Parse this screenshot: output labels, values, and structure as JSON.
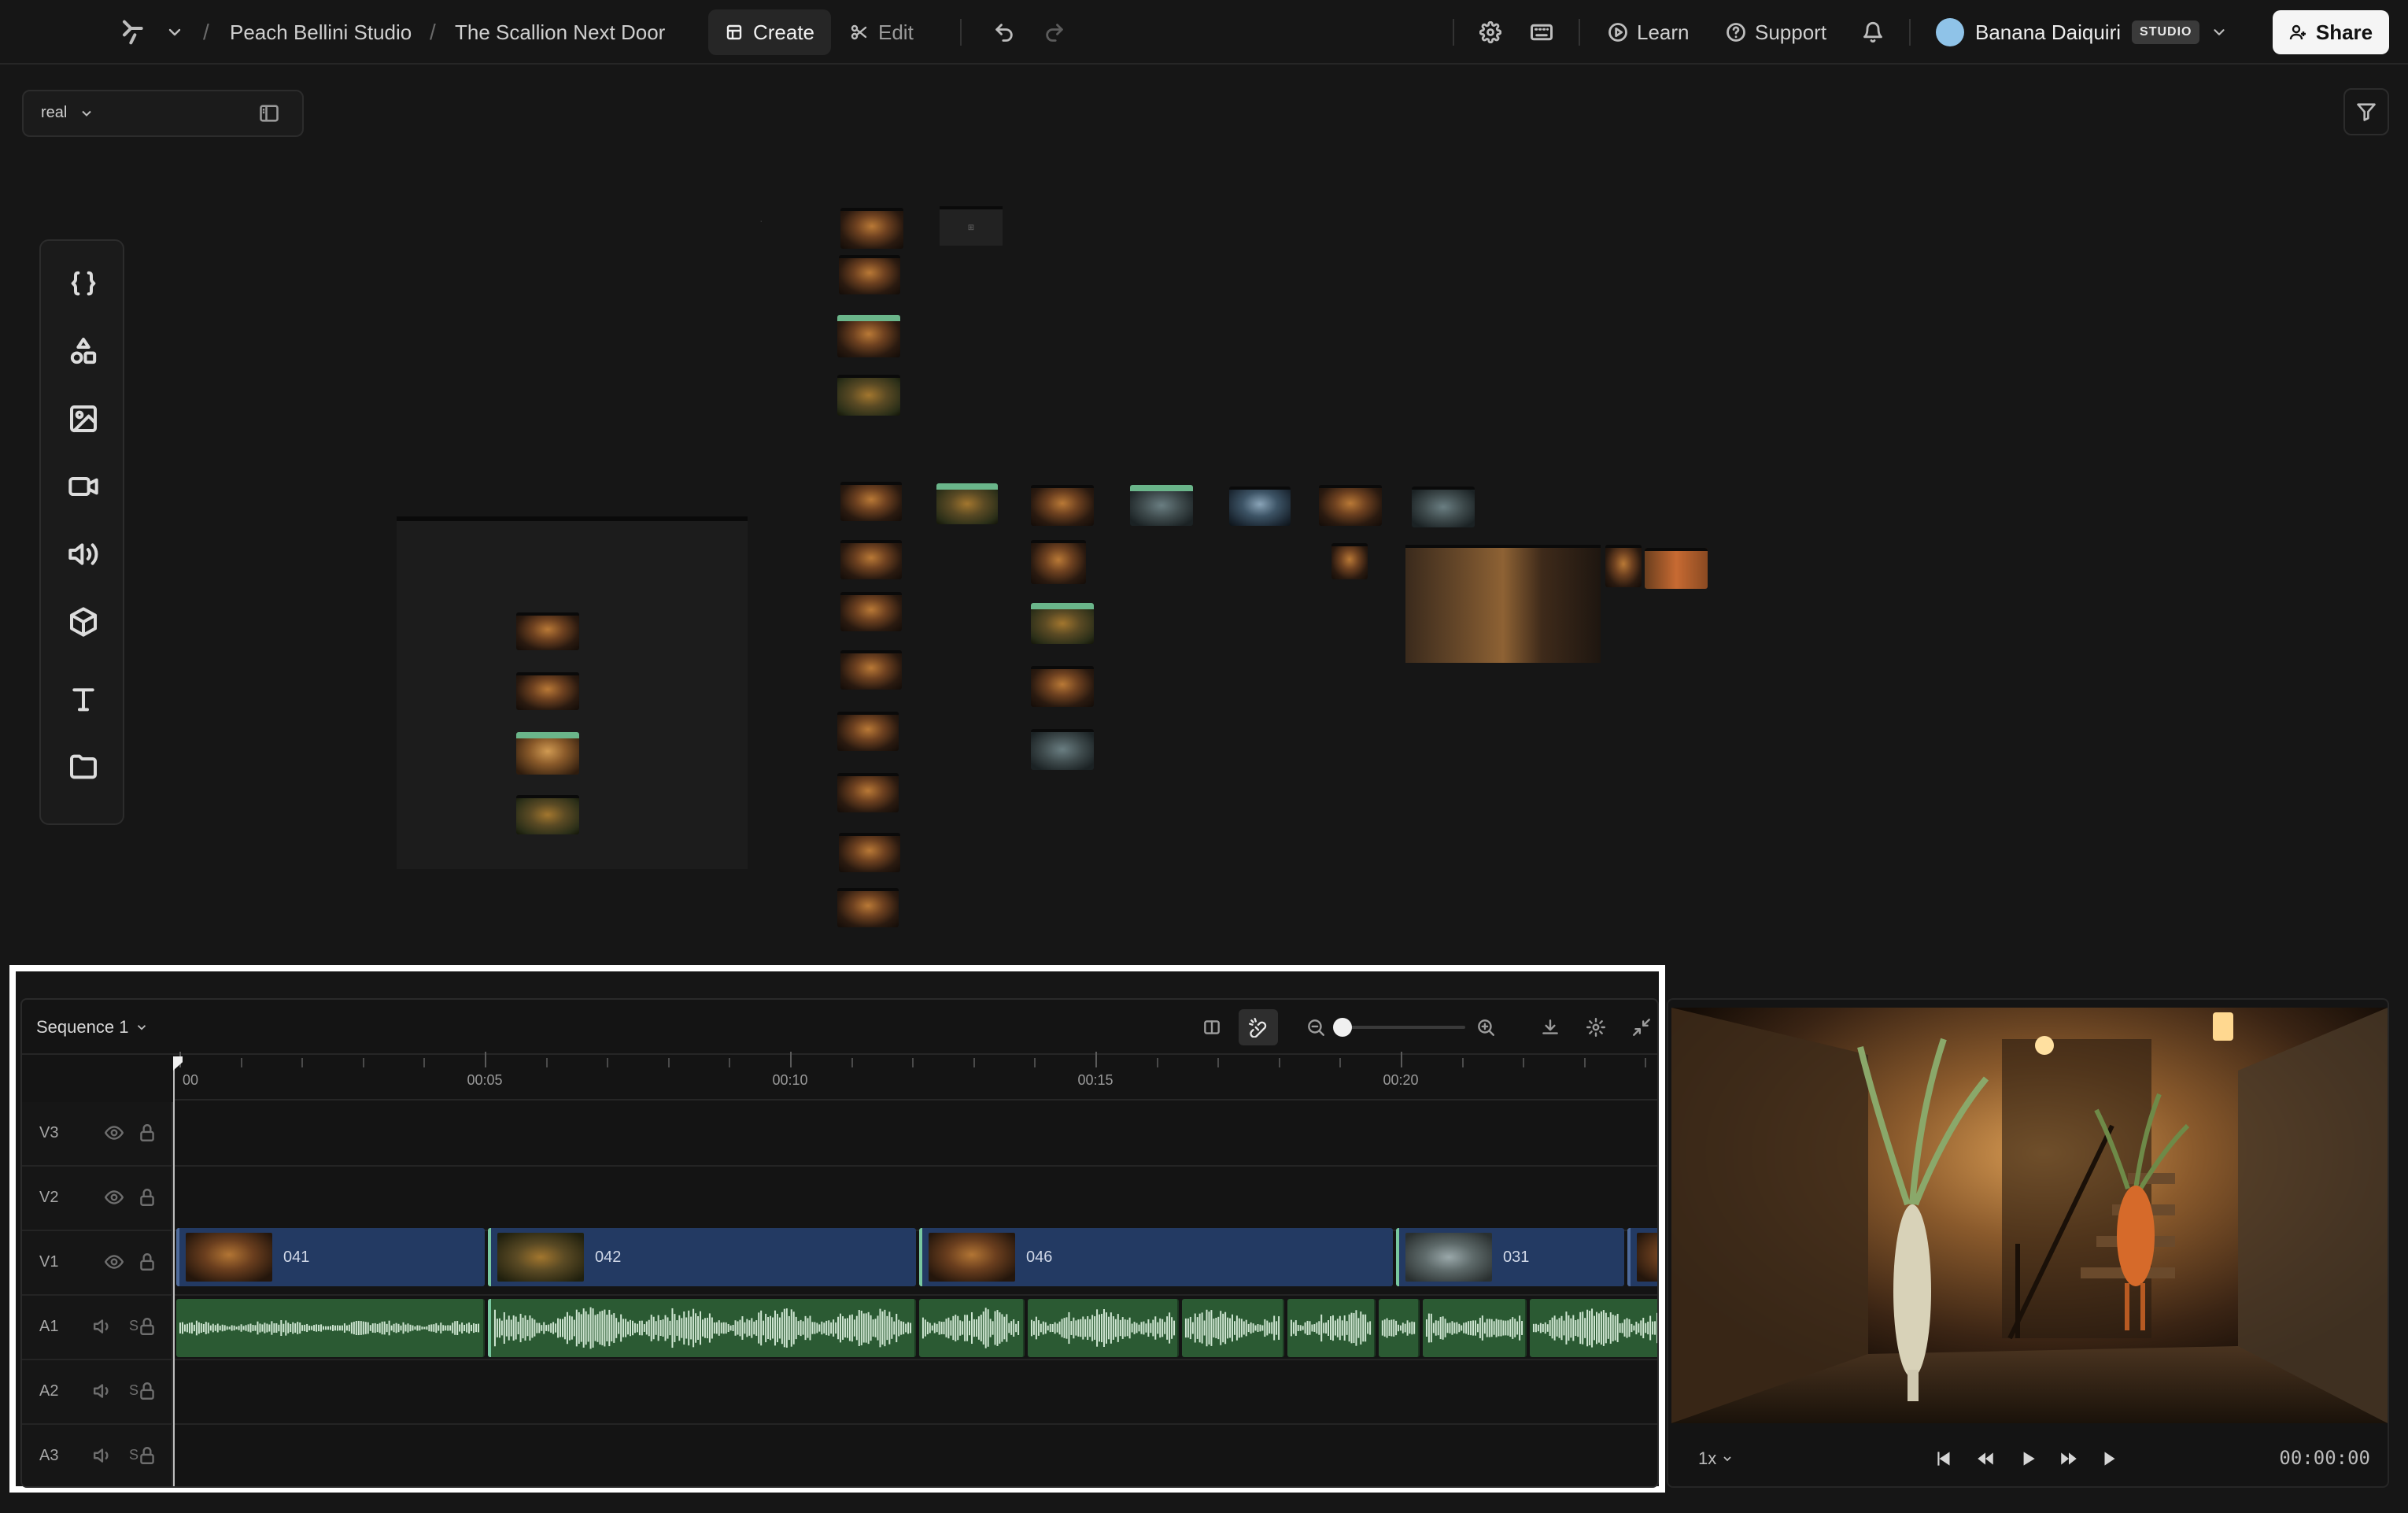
{
  "topbar": {
    "workspace": "Peach Bellini Studio",
    "project": "The Scallion Next Door",
    "create_label": "Create",
    "edit_label": "Edit",
    "learn_label": "Learn",
    "support_label": "Support",
    "user_name": "Banana Daiquiri",
    "plan_badge": "STUDIO",
    "share_label": "Share"
  },
  "canvas": {
    "view_value": "real"
  },
  "toolrail": {
    "items": [
      "code-icon",
      "shapes-icon",
      "image-icon",
      "video-icon",
      "audio-icon",
      "3d-icon",
      "text-icon",
      "folder-icon"
    ]
  },
  "timeline": {
    "sequence_name": "Sequence 1",
    "zoom": 0.0,
    "ruler": [
      "00",
      "00:05",
      "00:10",
      "00:15",
      "00:20"
    ],
    "tracks": [
      {
        "name": "V3",
        "kind": "video"
      },
      {
        "name": "V2",
        "kind": "video"
      },
      {
        "name": "V1",
        "kind": "video"
      },
      {
        "name": "A1",
        "kind": "audio"
      },
      {
        "name": "A2",
        "kind": "audio"
      },
      {
        "name": "A3",
        "kind": "audio"
      }
    ],
    "solo_label": "S",
    "clips": [
      {
        "label": "041"
      },
      {
        "label": "042"
      },
      {
        "label": "046"
      },
      {
        "label": "031"
      }
    ]
  },
  "preview": {
    "speed": "1x",
    "timecode": "00:00:00"
  },
  "colors": {
    "accent_green": "#78c8a0",
    "video_clip": "#233a63",
    "audio_clip": "#2b5a33",
    "background": "#161616"
  }
}
